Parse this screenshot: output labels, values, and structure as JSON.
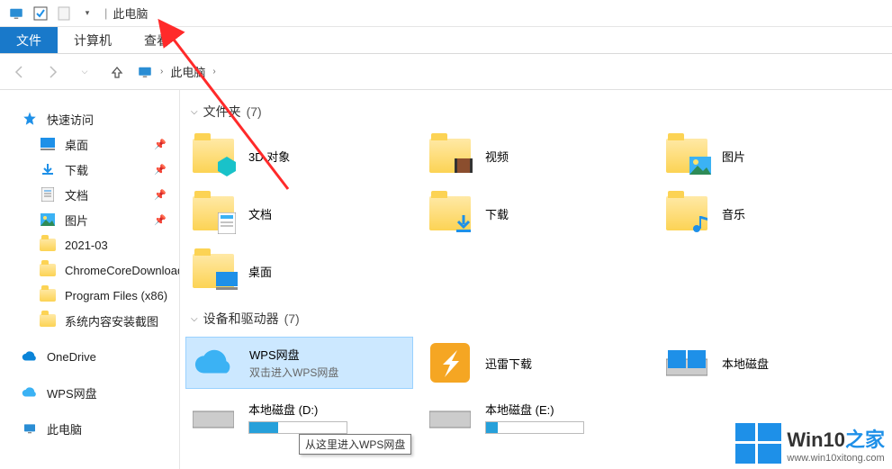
{
  "titlebar": {
    "title": "此电脑"
  },
  "ribbon": {
    "file": "文件",
    "computer": "计算机",
    "view": "查看"
  },
  "breadcrumb": {
    "root": "此电脑"
  },
  "sidebar": {
    "quick_access": "快速访问",
    "items": [
      {
        "label": "桌面",
        "pinned": true
      },
      {
        "label": "下载",
        "pinned": true
      },
      {
        "label": "文档",
        "pinned": true
      },
      {
        "label": "图片",
        "pinned": true
      },
      {
        "label": "2021-03",
        "pinned": false
      },
      {
        "label": "ChromeCoreDownloads",
        "pinned": false
      },
      {
        "label": "Program Files (x86)",
        "pinned": false
      },
      {
        "label": "系统内容安装截图",
        "pinned": false
      }
    ],
    "onedrive": "OneDrive",
    "wps": "WPS网盘",
    "thispc": "此电脑"
  },
  "sections": {
    "folders": {
      "label": "文件夹",
      "count": "(7)",
      "items": [
        {
          "label": "3D 对象"
        },
        {
          "label": "视频"
        },
        {
          "label": "图片"
        },
        {
          "label": "文档"
        },
        {
          "label": "下载"
        },
        {
          "label": "音乐"
        },
        {
          "label": "桌面"
        }
      ]
    },
    "devices": {
      "label": "设备和驱动器",
      "count": "(7)",
      "items": [
        {
          "label": "WPS网盘",
          "sub": "双击进入WPS网盘",
          "selected": true
        },
        {
          "label": "迅雷下载"
        },
        {
          "label": "本地磁盘"
        },
        {
          "label": "本地磁盘 (D:)",
          "is_drive": true
        },
        {
          "label": "本地磁盘 (E:)",
          "is_drive": true
        }
      ]
    }
  },
  "tooltip": "从这里进入WPS网盘",
  "watermark": {
    "brand": "Win10",
    "suffix": "之家",
    "url": "www.win10xitong.com"
  }
}
